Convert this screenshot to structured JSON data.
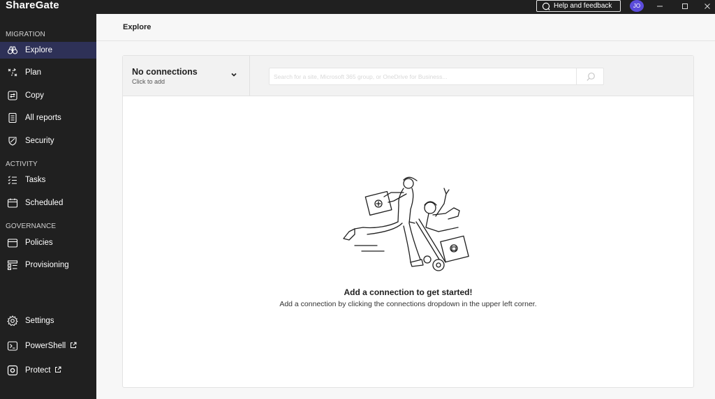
{
  "app": {
    "brand": "ShareGate",
    "help_label": "Help and feedback",
    "user_initials": "JO",
    "accent": "#5b4cdb"
  },
  "sidebar": {
    "sections": {
      "migration": "MIGRATION",
      "activity": "ACTIVITY",
      "governance": "GOVERNANCE"
    },
    "items": [
      {
        "label": "Explore",
        "icon": "binoculars-icon"
      },
      {
        "label": "Plan",
        "icon": "plan-icon"
      },
      {
        "label": "Copy",
        "icon": "copy-icon"
      },
      {
        "label": "All reports",
        "icon": "reports-icon"
      },
      {
        "label": "Security",
        "icon": "shield-icon"
      },
      {
        "label": "Tasks",
        "icon": "tasks-icon"
      },
      {
        "label": "Scheduled",
        "icon": "calendar-icon"
      },
      {
        "label": "Policies",
        "icon": "policies-icon"
      },
      {
        "label": "Provisioning",
        "icon": "provisioning-icon"
      },
      {
        "label": "Settings",
        "icon": "gear-icon"
      },
      {
        "label": "PowerShell",
        "icon": "terminal-icon"
      },
      {
        "label": "Protect",
        "icon": "protect-icon"
      }
    ]
  },
  "main": {
    "page_title": "Explore",
    "connection": {
      "title": "No connections",
      "subtitle": "Click to add"
    },
    "search": {
      "placeholder": "Search for a site, Microsoft 365 group, or OneDrive for Business..."
    },
    "empty": {
      "title": "Add a connection to get started!",
      "description": "Add a connection by clicking the connections dropdown in the upper left corner."
    }
  }
}
